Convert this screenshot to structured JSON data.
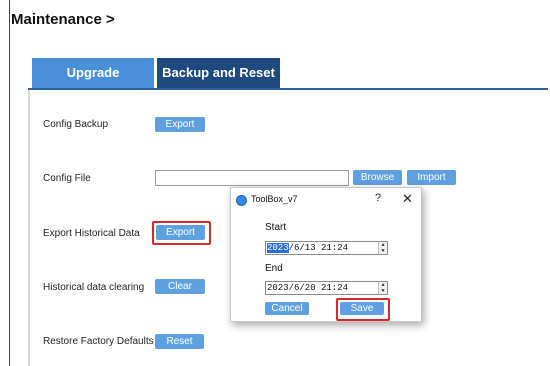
{
  "page": {
    "title": "Maintenance >"
  },
  "tabs": [
    {
      "label": "Upgrade",
      "active": false
    },
    {
      "label": "Backup and Reset",
      "active": true
    }
  ],
  "rows": {
    "config_backup": {
      "label": "Config Backup",
      "button": "Export"
    },
    "config_file": {
      "label": "Config File",
      "value": "",
      "browse": "Browse",
      "import": "Import"
    },
    "export_historical": {
      "label": "Export Historical Data",
      "button": "Export"
    },
    "historical_clearing": {
      "label": "Historical data clearing",
      "button": "Clear"
    },
    "restore_defaults": {
      "label": "Restore Factory Defaults",
      "button": "Reset"
    }
  },
  "dialog": {
    "title": "ToolBox_v7",
    "help": "?",
    "close": "✕",
    "start_label": "Start",
    "start_year": "2023",
    "start_rest": "/6/13 21:24",
    "end_label": "End",
    "end_value": "2023/6/20 21:24",
    "cancel": "Cancel",
    "save": "Save"
  },
  "colors": {
    "accent": "#5ea0e0",
    "tab_active": "#1f4a7f",
    "tab_inactive": "#4a90d9",
    "highlight": "#d9272e"
  }
}
